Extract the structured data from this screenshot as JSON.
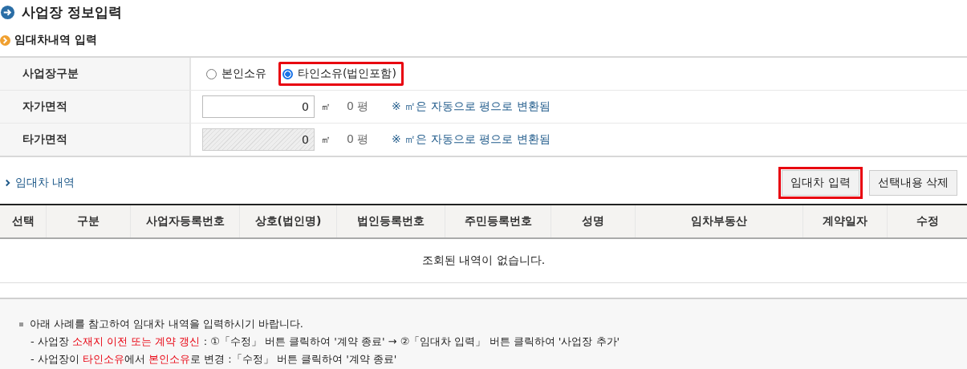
{
  "page_title": "사업장 정보입력",
  "section": {
    "title": "임대차내역 입력"
  },
  "form": {
    "rows": [
      {
        "kind": "radio",
        "label": "사업장구분",
        "options": [
          {
            "label": "본인소유",
            "selected": false,
            "highlighted": false
          },
          {
            "label": "타인소유(법인포함)",
            "selected": true,
            "highlighted": true
          }
        ]
      },
      {
        "kind": "area",
        "label": "자가면적",
        "value": "0",
        "disabled": false,
        "unit": "㎡",
        "pyeong": "0 평",
        "note": "※ ㎡은 자동으로 평으로 변환됨"
      },
      {
        "kind": "area",
        "label": "타가면적",
        "value": "0",
        "disabled": true,
        "unit": "㎡",
        "pyeong": "0 평",
        "note": "※ ㎡은 자동으로 평으로 변환됨"
      }
    ]
  },
  "lease": {
    "title": "임대차 내역",
    "buttons": [
      {
        "label": "임대차 입력",
        "highlighted": true
      },
      {
        "label": "선택내용 삭제",
        "highlighted": false
      }
    ],
    "columns": [
      "선택",
      "구분",
      "사업자등록번호",
      "상호(법인명)",
      "법인등록번호",
      "주민등록번호",
      "성명",
      "임차부동산",
      "계약일자",
      "수정"
    ],
    "empty_message": "조회된 내역이 없습니다."
  },
  "notice": {
    "intro": "아래 사례를 참고하여 임대차 내역을 입력하시기 바랍니다.",
    "lines": [
      "- 사업장 **소재지 이전 또는 계약 갱신** : ①「수정」 버튼 클릭하여 '계약 종료' → ②「임대차 입력」 버튼 클릭하여 '사업장 추가'",
      "- 사업장이 **타인소유**에서 **본인소유**로 변경 :「수정」 버튼 클릭하여 '계약 종료'"
    ]
  }
}
